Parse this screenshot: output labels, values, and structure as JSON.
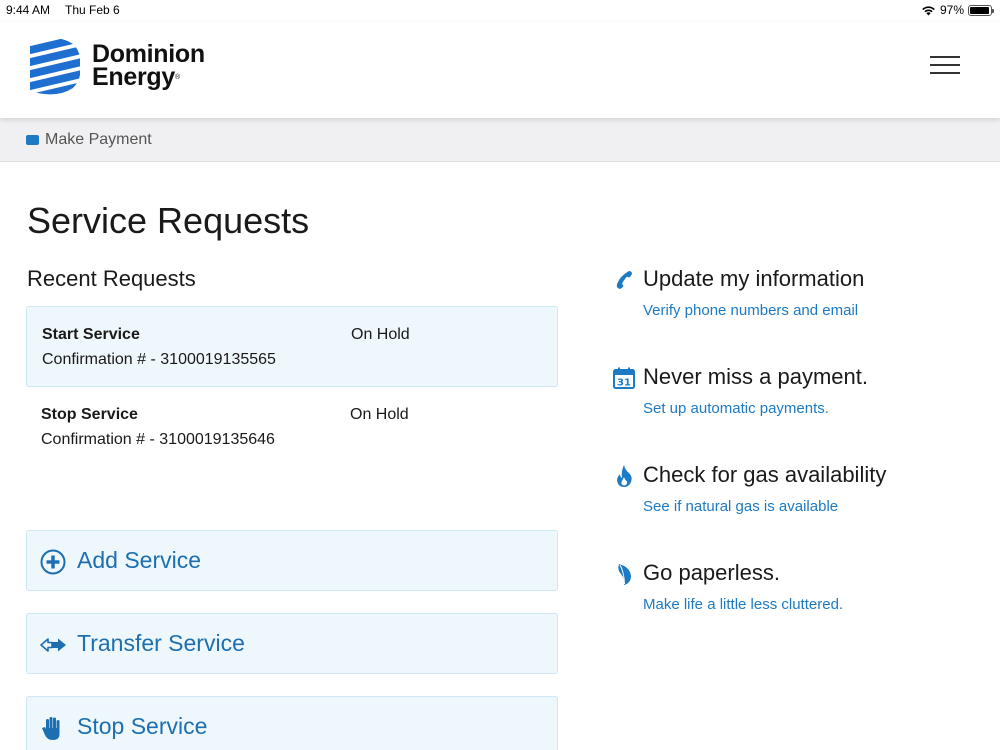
{
  "status_bar": {
    "time": "9:44 AM",
    "date": "Thu Feb 6",
    "battery": "97%",
    "battery_level": 0.97
  },
  "brand": {
    "line1": "Dominion",
    "line2": "Energy",
    "mark": "®",
    "color": "#1f6fd0"
  },
  "subnav": {
    "make_payment": "Make Payment"
  },
  "page": {
    "title": "Service Requests",
    "recent_title": "Recent Requests"
  },
  "requests": [
    {
      "title": "Start Service",
      "confirmation": "Confirmation # - 3100019135565",
      "status": "On Hold"
    },
    {
      "title": "Stop Service",
      "confirmation": "Confirmation # - 3100019135646",
      "status": "On Hold"
    }
  ],
  "actions": [
    {
      "label": "Add Service",
      "icon": "plus-circle-icon"
    },
    {
      "label": "Transfer Service",
      "icon": "transfer-arrows-icon"
    },
    {
      "label": "Stop Service",
      "icon": "stop-hand-icon"
    }
  ],
  "sidebar": [
    {
      "title": "Update my information",
      "link": "Verify phone numbers and email",
      "icon": "phone-icon"
    },
    {
      "title": "Never miss a payment.",
      "link": "Set up automatic payments.",
      "icon": "calendar-icon",
      "icon_text": "31"
    },
    {
      "title": "Check for gas availability",
      "link": "See if natural gas is available",
      "icon": "flame-icon"
    },
    {
      "title": "Go paperless.",
      "link": "Make life a little less cluttered.",
      "icon": "leaf-icon"
    }
  ],
  "colors": {
    "accent": "#1d7ac4",
    "panel": "#eef7fc",
    "panel_border": "#cfe6f3"
  }
}
